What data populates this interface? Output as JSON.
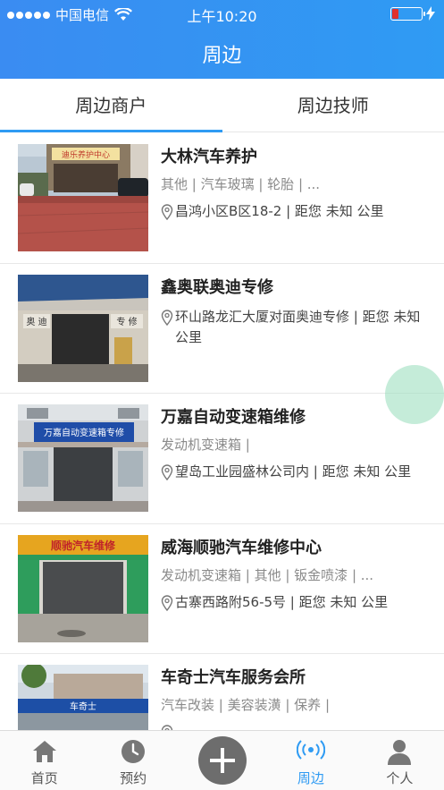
{
  "status_bar": {
    "carrier": "中国电信",
    "time": "上午10:20",
    "battery_level": 0.2,
    "battery_color": "#e0302e"
  },
  "nav": {
    "title": "周边"
  },
  "tabs": [
    {
      "label": "周边商户",
      "active": true
    },
    {
      "label": "周边技师",
      "active": false
    }
  ],
  "merchants": [
    {
      "name": "大林汽车养护",
      "categories": "其他 | 汽车玻璃 | 轮胎 | ...",
      "address": "昌鸿小区B区18-2 | 距您 未知 公里",
      "thumb_icon": "storefront-photo"
    },
    {
      "name": "鑫奥联奥迪专修",
      "categories": "",
      "address": "环山路龙汇大厦对面奥迪专修 | 距您 未知 公里",
      "thumb_icon": "garage-photo"
    },
    {
      "name": "万嘉自动变速箱维修",
      "categories": "发动机变速箱 |",
      "address": "望岛工业园盛林公司内 | 距您 未知 公里",
      "thumb_icon": "workshop-photo"
    },
    {
      "name": "威海顺驰汽车维修中心",
      "categories": "发动机变速箱 | 其他 | 钣金喷漆 | ...",
      "address": "古寨西路附56-5号 | 距您 未知 公里",
      "thumb_icon": "repair-shop-photo"
    },
    {
      "name": "车奇士汽车服务会所",
      "categories": "汽车改装 | 美容装潢 | 保养 |",
      "address": "",
      "thumb_icon": "service-club-photo"
    }
  ],
  "signs": {
    "shop1": "迪乐养护中心",
    "shop2_left": "奥 迪",
    "shop2_right": "专 修",
    "shop3": "万嘉自动变速箱专修",
    "shop4": "顺驰汽车维修",
    "shop5": "车奇士"
  },
  "tabbar": [
    {
      "label": "首页",
      "icon": "home-icon",
      "active": false
    },
    {
      "label": "预约",
      "icon": "clock-icon",
      "active": false
    },
    {
      "label": "",
      "icon": "plus-icon",
      "active": false
    },
    {
      "label": "周边",
      "icon": "nearby-signal-icon",
      "active": true
    },
    {
      "label": "个人",
      "icon": "person-icon",
      "active": false
    }
  ],
  "colors": {
    "brand": "#2f9bf3",
    "tab_underline": "#2f9bf3",
    "inactive_tab": "#555555"
  }
}
